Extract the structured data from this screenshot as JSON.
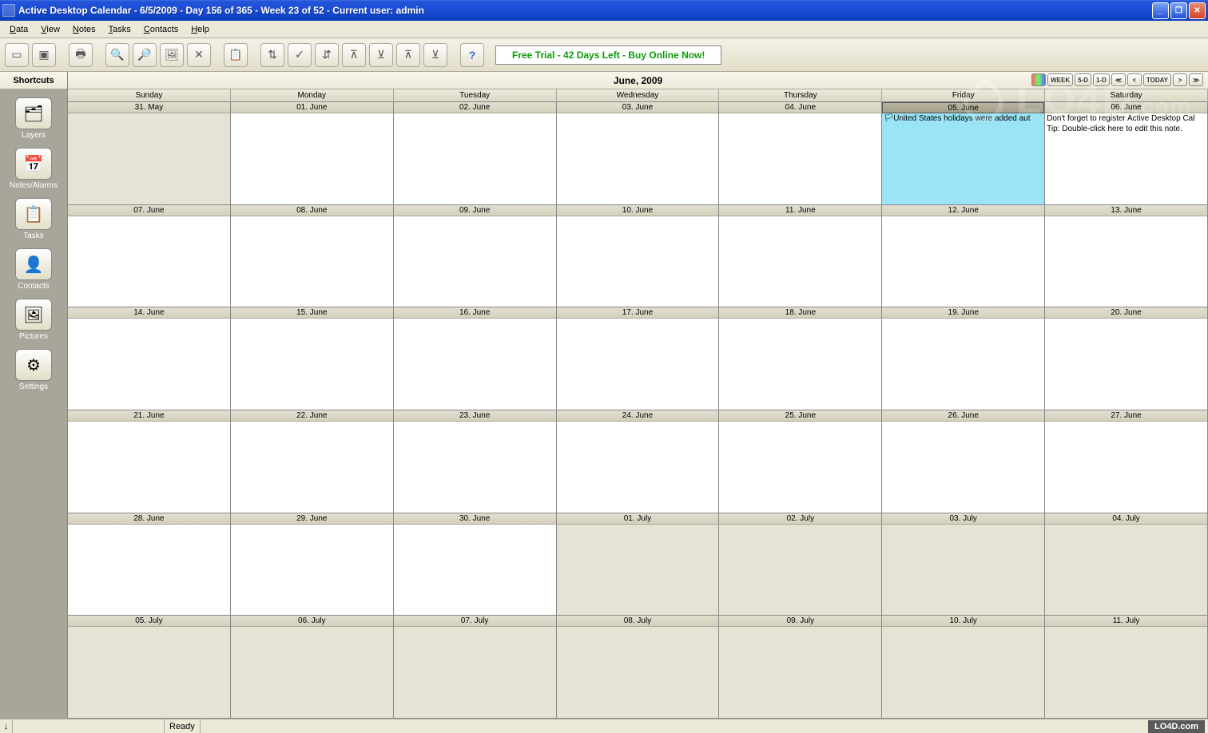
{
  "titlebar": {
    "text": "Active Desktop Calendar - 6/5/2009 - Day 156 of 365 - Week 23 of 52 - Current user: admin"
  },
  "menu": {
    "data": "Data",
    "view": "View",
    "notes": "Notes",
    "tasks": "Tasks",
    "contacts": "Contacts",
    "help": "Help"
  },
  "toolbar": {
    "trial": "Free Trial - 42 Days Left - Buy Online Now!"
  },
  "sidebar": {
    "header": "Shortcuts",
    "items": [
      {
        "label": "Layers",
        "icon": "🗂"
      },
      {
        "label": "Notes/Alarms",
        "icon": "📅"
      },
      {
        "label": "Tasks",
        "icon": "📋"
      },
      {
        "label": "Contacts",
        "icon": "👤"
      },
      {
        "label": "Pictures",
        "icon": "🖼"
      },
      {
        "label": "Settings",
        "icon": "⚙"
      }
    ]
  },
  "calendar": {
    "title": "June, 2009",
    "nav": {
      "week": "WEEK",
      "d5": "5-D",
      "d1": "1-D",
      "today": "TODAY"
    },
    "days": [
      "Sunday",
      "Monday",
      "Tuesday",
      "Wednesday",
      "Thursday",
      "Friday",
      "Saturday"
    ],
    "cells": [
      [
        {
          "d": "31. May",
          "c": 0
        },
        {
          "d": "01. June",
          "c": 1
        },
        {
          "d": "02. June",
          "c": 1
        },
        {
          "d": "03. June",
          "c": 1
        },
        {
          "d": "04. June",
          "c": 1
        },
        {
          "d": "05. June",
          "c": 2,
          "notes": [
            {
              "icon": "flag",
              "t": "United States holidays were added aut"
            }
          ]
        },
        {
          "d": "06. June",
          "c": 1,
          "notes": [
            {
              "t": "Don't forget to register Active Desktop Cal"
            },
            {
              "t": "Tip: Double-click here to edit this note."
            }
          ]
        }
      ],
      [
        {
          "d": "07. June",
          "c": 1
        },
        {
          "d": "08. June",
          "c": 1
        },
        {
          "d": "09. June",
          "c": 1
        },
        {
          "d": "10. June",
          "c": 1
        },
        {
          "d": "11. June",
          "c": 1
        },
        {
          "d": "12. June",
          "c": 1
        },
        {
          "d": "13. June",
          "c": 1
        }
      ],
      [
        {
          "d": "14. June",
          "c": 1
        },
        {
          "d": "15. June",
          "c": 1
        },
        {
          "d": "16. June",
          "c": 1
        },
        {
          "d": "17. June",
          "c": 1
        },
        {
          "d": "18. June",
          "c": 1
        },
        {
          "d": "19. June",
          "c": 1
        },
        {
          "d": "20. June",
          "c": 1
        }
      ],
      [
        {
          "d": "21. June",
          "c": 1
        },
        {
          "d": "22. June",
          "c": 1
        },
        {
          "d": "23. June",
          "c": 1
        },
        {
          "d": "24. June",
          "c": 1
        },
        {
          "d": "25. June",
          "c": 1
        },
        {
          "d": "26. June",
          "c": 1
        },
        {
          "d": "27. June",
          "c": 1
        }
      ],
      [
        {
          "d": "28. June",
          "c": 1
        },
        {
          "d": "29. June",
          "c": 1
        },
        {
          "d": "30. June",
          "c": 1
        },
        {
          "d": "01. July",
          "c": 0
        },
        {
          "d": "02. July",
          "c": 0
        },
        {
          "d": "03. July",
          "c": 0
        },
        {
          "d": "04. July",
          "c": 0
        }
      ],
      [
        {
          "d": "05. July",
          "c": 0
        },
        {
          "d": "06. July",
          "c": 0
        },
        {
          "d": "07. July",
          "c": 0
        },
        {
          "d": "08. July",
          "c": 0
        },
        {
          "d": "09. July",
          "c": 0
        },
        {
          "d": "10. July",
          "c": 0
        },
        {
          "d": "11. July",
          "c": 0
        }
      ]
    ]
  },
  "status": {
    "ready": "Ready",
    "arrow": "↓"
  },
  "watermark": {
    "text": "LO4D",
    "footer": "LO4D.com"
  }
}
